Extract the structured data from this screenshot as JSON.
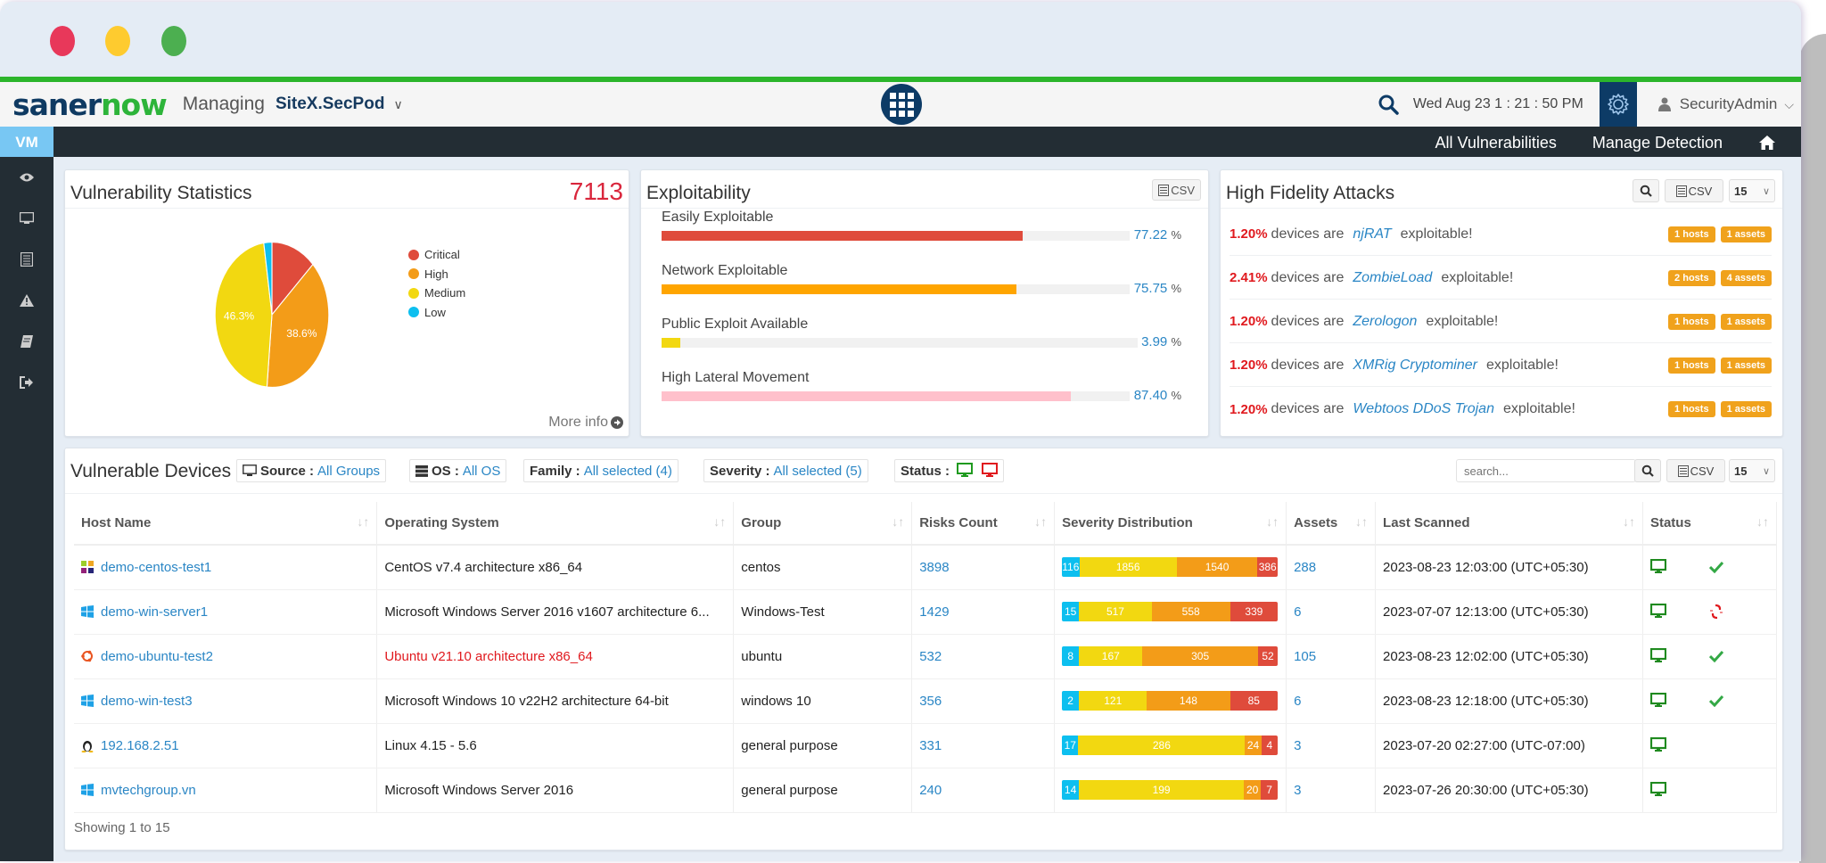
{
  "window": {
    "traffic_lights": [
      "#e8385a",
      "#fecb2f",
      "#4caf50"
    ]
  },
  "header": {
    "logo_part1": "saner",
    "logo_part2": "now",
    "managing_label": "Managing",
    "site_name": "SiteX.SecPod",
    "datetime": "Wed Aug 23  1 : 21 : 50 PM",
    "user": "SecurityAdmin"
  },
  "subnav": {
    "active_tab": "VM",
    "links": [
      "All Vulnerabilities",
      "Manage Detection"
    ]
  },
  "sidebar": {
    "icons": [
      "eye-icon",
      "monitor-icon",
      "list-icon",
      "warning-icon",
      "book-icon",
      "sign-out-icon"
    ]
  },
  "vuln_stats": {
    "title": "Vulnerability Statistics",
    "total": "7113",
    "more_info": "More info",
    "chart_data": {
      "type": "pie",
      "title": "Vulnerability Statistics",
      "legend_position": "right",
      "slices": [
        {
          "name": "Critical",
          "value": 12.8,
          "color": "#df4b3b",
          "label": ""
        },
        {
          "name": "High",
          "value": 38.6,
          "color": "#f39c18",
          "label": "38.6%"
        },
        {
          "name": "Medium",
          "value": 46.3,
          "color": "#f2d811",
          "label": "46.3%"
        },
        {
          "name": "Low",
          "value": 2.3,
          "color": "#0dbfef",
          "label": ""
        }
      ]
    }
  },
  "exploitability": {
    "title": "Exploitability",
    "csv_label": "CSV",
    "items": [
      {
        "label": "Easily Exploitable",
        "value": "77.22",
        "pct": 77.22,
        "color": "#df4b3b"
      },
      {
        "label": "Network Exploitable",
        "value": "75.75",
        "pct": 75.75,
        "color": "#ffa500"
      },
      {
        "label": "Public Exploit Available",
        "value": "3.99",
        "pct": 3.99,
        "color": "#f2d811"
      },
      {
        "label": "High Lateral Movement",
        "value": "87.40",
        "pct": 87.4,
        "color": "#ffc0cb"
      }
    ],
    "unit": "%"
  },
  "hfa": {
    "title": "High Fidelity Attacks",
    "csv_label": "CSV",
    "page_size": "15",
    "devices_are": "devices are",
    "exploitable": "exploitable!",
    "items": [
      {
        "pct": "1.20%",
        "name": "njRAT",
        "hosts": "1 hosts",
        "assets": "1 assets"
      },
      {
        "pct": "2.41%",
        "name": "ZombieLoad",
        "hosts": "2 hosts",
        "assets": "4 assets"
      },
      {
        "pct": "1.20%",
        "name": "Zerologon",
        "hosts": "1 hosts",
        "assets": "1 assets"
      },
      {
        "pct": "1.20%",
        "name": "XMRig Cryptominer",
        "hosts": "1 hosts",
        "assets": "1 assets"
      },
      {
        "pct": "1.20%",
        "name": "Webtoos DDoS Trojan",
        "hosts": "1 hosts",
        "assets": "1 assets"
      }
    ]
  },
  "devices": {
    "title": "Vulnerable Devices",
    "filters": {
      "source_label": "Source :",
      "source_value": "All Groups",
      "os_label": "OS :",
      "os_value": "All OS",
      "family_label": "Family :",
      "family_value": "All selected (4)",
      "severity_label": "Severity :",
      "severity_value": "All selected (5)",
      "status_label": "Status :"
    },
    "search_placeholder": "search...",
    "csv_label": "CSV",
    "page_size": "15",
    "columns": [
      "Host Name",
      "Operating System",
      "Group",
      "Risks Count",
      "Severity Distribution",
      "Assets",
      "Last Scanned",
      "Status"
    ],
    "severity_colors": {
      "low": "#0dbfef",
      "medium": "#f2d811",
      "high": "#f39c18",
      "critical": "#df4b3b"
    },
    "rows": [
      {
        "os_icon": "centos-icon",
        "host": "demo-centos-test1",
        "os": "CentOS v7.4 architecture x86_64",
        "os_alert": false,
        "group": "centos",
        "risks": "3898",
        "sev": [
          116,
          1856,
          1540,
          386
        ],
        "assets": "288",
        "scanned": "2023-08-23 12:03:00 (UTC+05:30)",
        "online": true,
        "extra": "check"
      },
      {
        "os_icon": "windows-icon",
        "host": "demo-win-server1",
        "os": "Microsoft Windows Server 2016 v1607 architecture 6...",
        "os_alert": false,
        "group": "Windows-Test",
        "risks": "1429",
        "sev": [
          15,
          517,
          558,
          339
        ],
        "assets": "6",
        "scanned": "2023-07-07 12:13:00 (UTC+05:30)",
        "online": true,
        "extra": "broken-link"
      },
      {
        "os_icon": "ubuntu-icon",
        "host": "demo-ubuntu-test2",
        "os": "Ubuntu v21.10 architecture x86_64",
        "os_alert": true,
        "group": "ubuntu",
        "risks": "532",
        "sev": [
          8,
          167,
          305,
          52
        ],
        "assets": "105",
        "scanned": "2023-08-23 12:02:00 (UTC+05:30)",
        "online": true,
        "extra": "check"
      },
      {
        "os_icon": "windows-icon",
        "host": "demo-win-test3",
        "os": "Microsoft Windows 10 v22H2 architecture 64-bit",
        "os_alert": false,
        "group": "windows 10",
        "risks": "356",
        "sev": [
          2,
          121,
          148,
          85
        ],
        "assets": "6",
        "scanned": "2023-08-23 12:18:00 (UTC+05:30)",
        "online": true,
        "extra": "check"
      },
      {
        "os_icon": "linux-icon",
        "host": "192.168.2.51",
        "os": "Linux 4.15 - 5.6",
        "os_alert": false,
        "group": "general purpose",
        "risks": "331",
        "sev": [
          17,
          286,
          24,
          4
        ],
        "assets": "3",
        "scanned": "2023-07-20 02:27:00 (UTC-07:00)",
        "online": true,
        "extra": ""
      },
      {
        "os_icon": "windows-icon",
        "host": "mvtechgroup.vn",
        "os": "Microsoft Windows Server 2016",
        "os_alert": false,
        "group": "general purpose",
        "risks": "240",
        "sev": [
          14,
          199,
          20,
          7
        ],
        "assets": "3",
        "scanned": "2023-07-26 20:30:00 (UTC+05:30)",
        "online": true,
        "extra": ""
      }
    ],
    "showing": "Showing 1 to 15"
  }
}
